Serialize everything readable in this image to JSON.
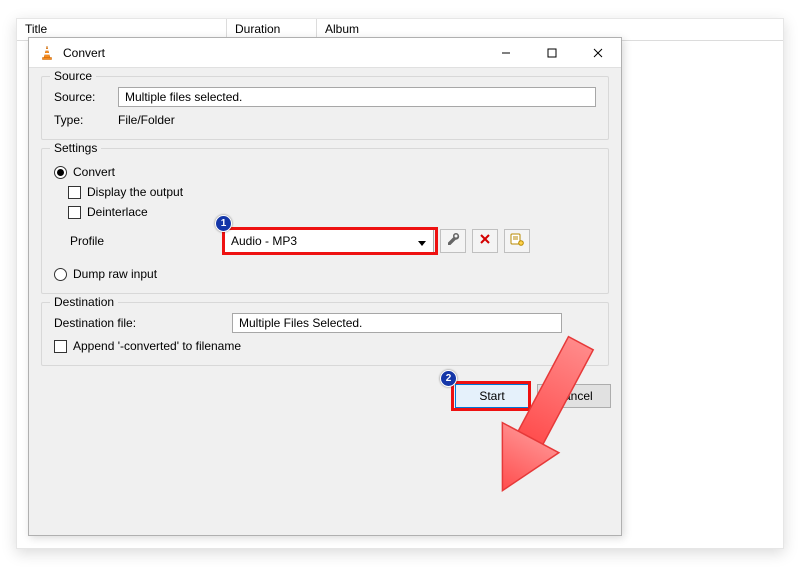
{
  "tableHeader": {
    "title": "Title",
    "duration": "Duration",
    "album": "Album"
  },
  "dialog": {
    "title": "Convert",
    "source": {
      "groupTitle": "Source",
      "sourceLabel": "Source:",
      "sourceValue": "Multiple files selected.",
      "typeLabel": "Type:",
      "typeValue": "File/Folder"
    },
    "settings": {
      "groupTitle": "Settings",
      "convert": "Convert",
      "displayOutput": "Display the output",
      "deinterlace": "Deinterlace",
      "profileLabel": "Profile",
      "profileValue": "Audio - MP3",
      "dumpRaw": "Dump raw input"
    },
    "destination": {
      "groupTitle": "Destination",
      "fileLabel": "Destination file:",
      "fileValue": "Multiple Files Selected.",
      "append": "Append '-converted' to filename"
    },
    "buttons": {
      "start": "Start",
      "cancel": "Cancel"
    }
  },
  "annotations": {
    "badge1": "1",
    "badge2": "2"
  }
}
